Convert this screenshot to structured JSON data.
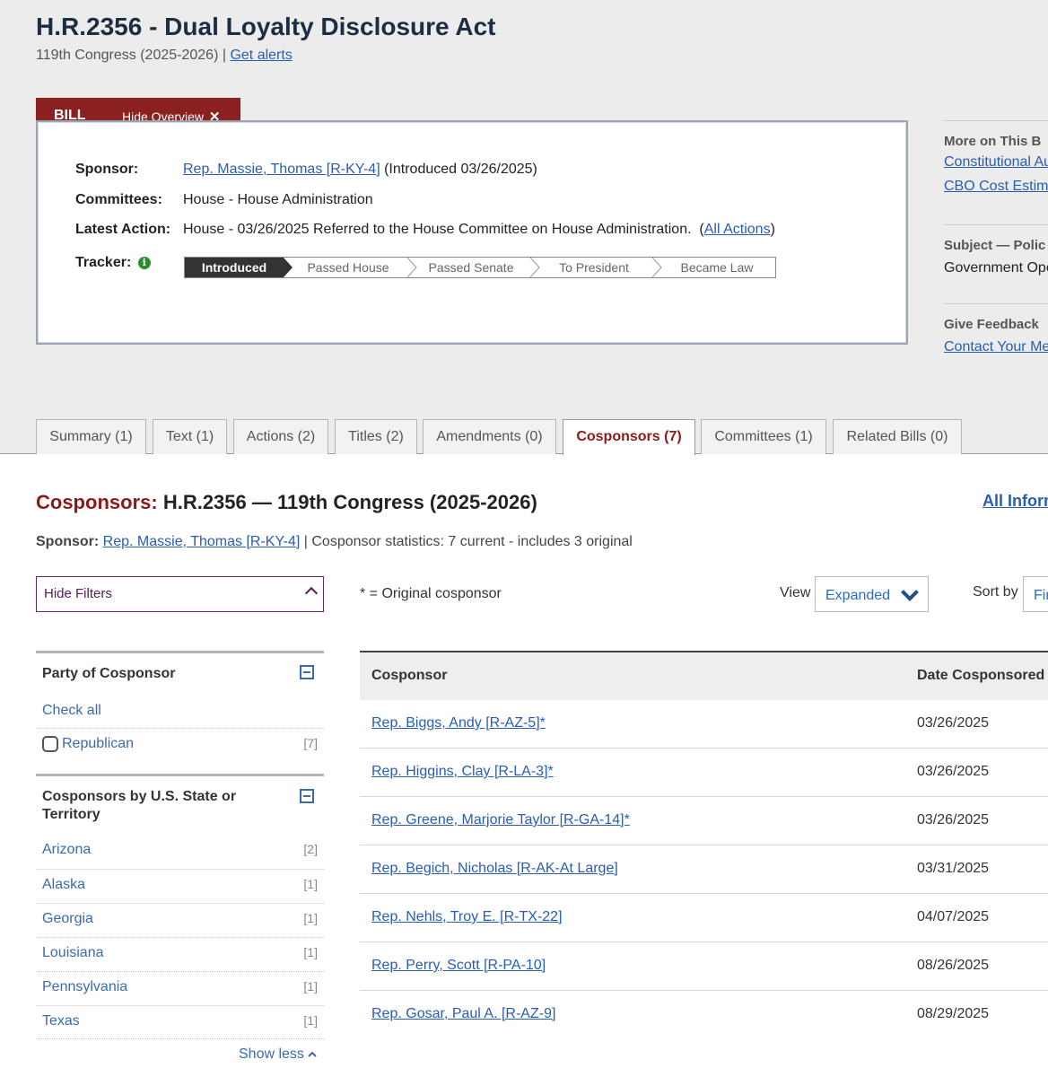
{
  "bill": {
    "title": "H.R.2356 - Dual Loyalty Disclosure Act",
    "congress": "119th Congress (2025-2026)",
    "separator": "|",
    "get_alerts": "Get alerts"
  },
  "overview_tab": {
    "label": "BILL",
    "hide_overview": "Hide Overview",
    "close_glyph": "✕"
  },
  "overview": {
    "sponsor_label": "Sponsor:",
    "sponsor_link": "Rep. Massie, Thomas [R-KY-4]",
    "sponsor_introduced": "(Introduced 03/26/2025)",
    "committees_label": "Committees:",
    "committees_value": "House - House Administration",
    "latest_action_label": "Latest Action:",
    "latest_action_value": "House - 03/26/2025 Referred to the House Committee on House Administration.",
    "all_actions": "All Actions",
    "tracker_label": "Tracker:",
    "tracker_info_glyph": "i",
    "tracker_steps": [
      "Introduced",
      "Passed House",
      "Passed Senate",
      "To President",
      "Became Law"
    ],
    "tracker_current": "Introduced"
  },
  "sidebar": {
    "more_head": "More on This B",
    "more_links": [
      "Constitutional Au",
      "CBO Cost Estim"
    ],
    "subject_head": "Subject — Polic",
    "subject_value": "Government Ope",
    "feedback_head": "Give Feedback",
    "feedback_link": "Contact Your Me"
  },
  "tabs": [
    {
      "label": "Summary (1)",
      "active": false
    },
    {
      "label": "Text (1)",
      "active": false
    },
    {
      "label": "Actions (2)",
      "active": false
    },
    {
      "label": "Titles (2)",
      "active": false
    },
    {
      "label": "Amendments (0)",
      "active": false
    },
    {
      "label": "Cosponsors (7)",
      "active": true
    },
    {
      "label": "Committees (1)",
      "active": false
    },
    {
      "label": "Related Bills (0)",
      "active": false
    }
  ],
  "cosponsors": {
    "title_prefix": "Cosponsors:",
    "title_rest": "H.R.2356 — 119th Congress (2025-2026)",
    "all_info": "All Inform",
    "sponsor_label": "Sponsor:",
    "sponsor_link": "Rep. Massie, Thomas [R-KY-4]",
    "statistics": "| Cosponsor statistics: 7 current - includes 3 original",
    "hide_filters": "Hide Filters",
    "original_note": "* = Original cosponsor",
    "view_label": "View",
    "view_value": "Expanded",
    "sort_label": "Sort by",
    "sort_value": "Fir"
  },
  "filters": {
    "party": {
      "heading": "Party of Cosponsor",
      "check_all": "Check all",
      "items": [
        {
          "label": "Republican",
          "count": "[7]"
        }
      ]
    },
    "state": {
      "heading": "Cosponsors by U.S. State or Territory",
      "items": [
        {
          "label": "Arizona",
          "count": "[2]"
        },
        {
          "label": "Alaska",
          "count": "[1]"
        },
        {
          "label": "Georgia",
          "count": "[1]"
        },
        {
          "label": "Louisiana",
          "count": "[1]"
        },
        {
          "label": "Pennsylvania",
          "count": "[1]"
        },
        {
          "label": "Texas",
          "count": "[1]"
        }
      ],
      "show_less": "Show less"
    }
  },
  "table": {
    "col_cosponsor": "Cosponsor",
    "col_date": "Date Cosponsored",
    "rows": [
      {
        "name": "Rep. Biggs, Andy [R-AZ-5]*",
        "date": "03/26/2025"
      },
      {
        "name": "Rep. Higgins, Clay [R-LA-3]*",
        "date": "03/26/2025"
      },
      {
        "name": "Rep. Greene, Marjorie Taylor [R-GA-14]*",
        "date": "03/26/2025"
      },
      {
        "name": "Rep. Begich, Nicholas [R-AK-At Large]",
        "date": "03/31/2025"
      },
      {
        "name": "Rep. Nehls, Troy E. [R-TX-22]",
        "date": "04/07/2025"
      },
      {
        "name": "Rep. Perry, Scott [R-PA-10]",
        "date": "08/26/2025"
      },
      {
        "name": "Rep. Gosar, Paul A. [R-AZ-9]",
        "date": "08/29/2025"
      }
    ]
  },
  "colors": {
    "accent_red": "#8b1a1a",
    "link_blue": "#2a5db0",
    "tracker_active": "#333333",
    "filter_purple": "#5b1a5a"
  }
}
